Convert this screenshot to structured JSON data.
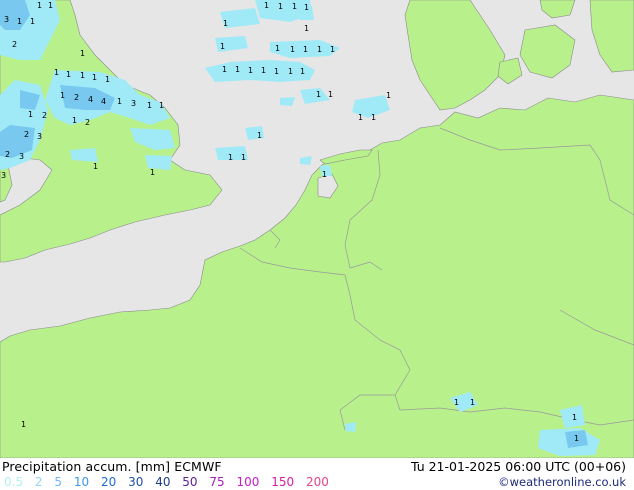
{
  "footer": {
    "title": "Precipitation accum. [mm] ECMWF",
    "timestamp": "Tu 21-01-2025 06:00 UTC (00+06)",
    "credit": "©weatheronline.co.uk"
  },
  "legend": [
    {
      "label": "0.5",
      "color": "#b4f0f0"
    },
    {
      "label": "2",
      "color": "#96d2fa"
    },
    {
      "label": "5",
      "color": "#78b4fa"
    },
    {
      "label": "10",
      "color": "#3c96f5"
    },
    {
      "label": "20",
      "color": "#1e6ed2"
    },
    {
      "label": "30",
      "color": "#1e50a0"
    },
    {
      "label": "40",
      "color": "#1e3c8c"
    },
    {
      "label": "50",
      "color": "#5a1e96"
    },
    {
      "label": "75",
      "color": "#a01eb4"
    },
    {
      "label": "100",
      "color": "#c81ec8"
    },
    {
      "label": "150",
      "color": "#dc1ea0"
    },
    {
      "label": "200",
      "color": "#e6468c"
    }
  ],
  "colors": {
    "sea": "#e6e6e6",
    "land": "#b8f08c",
    "border": "#a0a0a0",
    "precip_light": "#a0eaf8",
    "precip_medium": "#78c8f0"
  },
  "map_values": [
    "1",
    "2",
    "3",
    "4"
  ]
}
